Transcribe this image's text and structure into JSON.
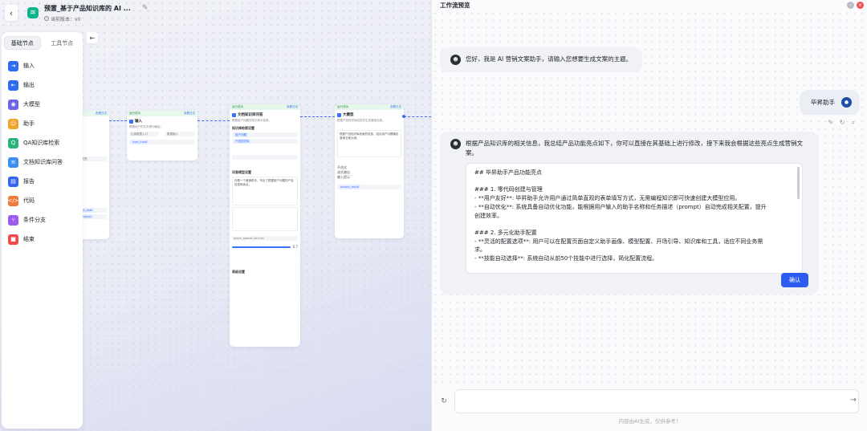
{
  "header": {
    "title": "预置_基于产品知识库的 AI ...",
    "version": "当前版本：v0"
  },
  "node_panel": {
    "tabs": [
      {
        "label": "基础节点",
        "active": true
      },
      {
        "label": "工具节点",
        "active": false
      }
    ],
    "items": [
      {
        "label": "输入",
        "icon": "input-icon",
        "color": "#2f6af2",
        "glyph": "⇥"
      },
      {
        "label": "输出",
        "icon": "output-icon",
        "color": "#2f6af2",
        "glyph": "⇤"
      },
      {
        "label": "大模型",
        "icon": "llm-icon",
        "color": "#6c63e8",
        "glyph": "◉"
      },
      {
        "label": "助手",
        "icon": "assistant-icon",
        "color": "#f0a429",
        "glyph": "☺"
      },
      {
        "label": "QA知识库检索",
        "icon": "qa-search-icon",
        "color": "#28b37a",
        "glyph": "Q"
      },
      {
        "label": "文档知识库问答",
        "icon": "doc-qa-icon",
        "color": "#3b8df0",
        "glyph": "≡"
      },
      {
        "label": "报告",
        "icon": "report-icon",
        "color": "#3466f2",
        "glyph": "▤"
      },
      {
        "label": "代码",
        "icon": "code-icon",
        "color": "#f07c3a",
        "glyph": "</>"
      },
      {
        "label": "条件分支",
        "icon": "branch-icon",
        "color": "#9c5cf0",
        "glyph": "⑂"
      },
      {
        "label": "结束",
        "icon": "end-icon",
        "color": "#ef4b4b",
        "glyph": "■"
      }
    ]
  },
  "canvas": {
    "node_input": {
      "head": "运行成功",
      "head_r": "查看日志",
      "title": "输入",
      "desc": "根据用户的文本提问输出。",
      "field1": "比读数据入口",
      "field2": "数据输入",
      "var": "user_input"
    },
    "node_doc": {
      "head": "运行成功",
      "head_r": "查看日志",
      "title": "文档知识库问答",
      "desc": "根据用户问题在知识库中检索。",
      "section1": "知识库检索设置",
      "tag1": "用户问题",
      "tag2": "产品知识库",
      "section2": "问答模型设置",
      "prompt": "你是一个营销助手，写出了根据用户问题的产品信息和卖点。",
      "model": "azure_openai-4o-mini",
      "temp": "0.7",
      "footer": "高级设置"
    },
    "node_llm": {
      "head": "运行成功",
      "head_r": "查看日志",
      "title": "大模型",
      "desc": "根据产品知识库回答并生成营销文案。",
      "prompt": "根据产品知识库检索的信息，结合用户问题输出营销文案大纲。",
      "options": [
        "不流式",
        "流式输出",
        "输入提示"
      ],
      "var": "output_result"
    },
    "side_labels": [
      "查看日志",
      "请输入文档",
      "current_date",
      "chat_history"
    ]
  },
  "preview": {
    "title": "工作流预览",
    "bot_greeting": "您好，我是 AI 营销文案助手，请输入您想要生成文案的主题。",
    "user_message": "毕昇助手",
    "bot_reply_intro": "根据产品知识库的相关信息，我总结产品功能亮点如下，你可以直接在其基础上进行修改，接下来我会根据这些亮点生成营销文案。",
    "editor_lines": [
      "## 毕昇助手产品功能亮点",
      "",
      "### 1. 零代码创建与管理",
      "- **用户友好**: 毕昇助手允许用户通过简单直观的表单填写方式，无需编程知识即可快速创建大模型应用。",
      "- **自动优化**: 系统具备自动优化功能，能根据用户输入的助手名称和任务描述（prompt）自动完成相关配置，提升",
      "创建效率。",
      "",
      "### 2. 多元化助手配置",
      "- **灵活的配置选项**: 用户可以在配置页面自定义助手画像、模型配置、开场引导、知识库和工具，适应不同业务需",
      "求。",
      "- **技能自动选择**: 系统自动从前50个技能中进行选择，简化配置流程。"
    ],
    "confirm_label": "确认",
    "input_value": "",
    "footer_note": "内容由AI生成，仅供参考！"
  }
}
